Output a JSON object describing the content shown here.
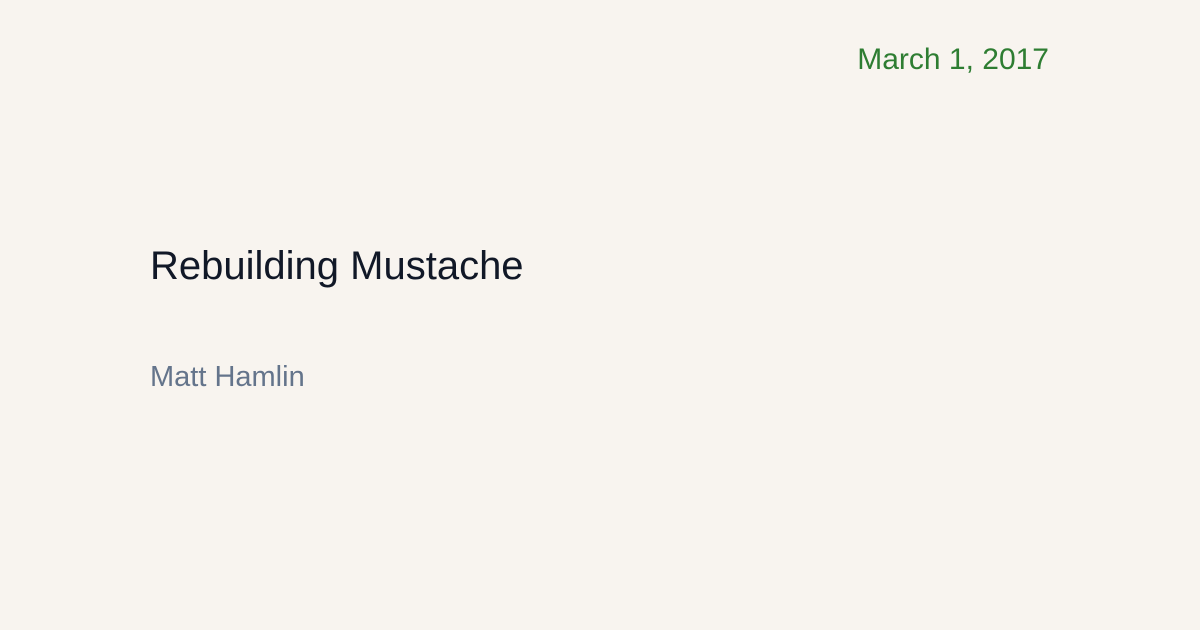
{
  "card": {
    "date": "March 1, 2017",
    "title": "Rebuilding Mustache",
    "author": "Matt Hamlin"
  },
  "colors": {
    "background": "#f8f4ef",
    "date": "#2e7d32",
    "title": "#111827",
    "author": "#64748b"
  }
}
